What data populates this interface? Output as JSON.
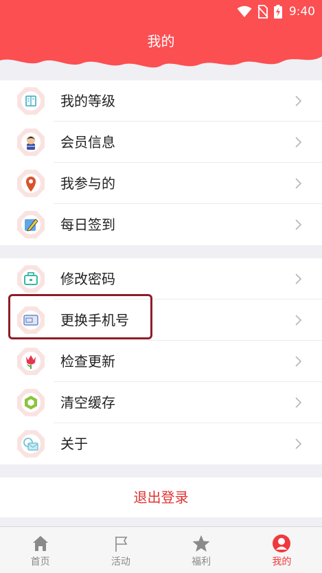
{
  "status_bar": {
    "time": "9:40"
  },
  "header": {
    "title": "我的"
  },
  "groups": [
    {
      "items": [
        {
          "label": "我的等级"
        },
        {
          "label": "会员信息"
        },
        {
          "label": "我参与的"
        },
        {
          "label": "每日签到"
        }
      ]
    },
    {
      "items": [
        {
          "label": "修改密码"
        },
        {
          "label": "更换手机号"
        },
        {
          "label": "检查更新"
        },
        {
          "label": "清空缓存"
        },
        {
          "label": "关于"
        }
      ]
    }
  ],
  "logout": {
    "label": "退出登录"
  },
  "tabs": [
    {
      "label": "首页"
    },
    {
      "label": "活动"
    },
    {
      "label": "福利"
    },
    {
      "label": "我的"
    }
  ],
  "colors": {
    "brand": "#fb4f52",
    "accent_text": "#e0312f",
    "active_tab": "#f0393c",
    "highlight_border": "#8e1c28"
  }
}
